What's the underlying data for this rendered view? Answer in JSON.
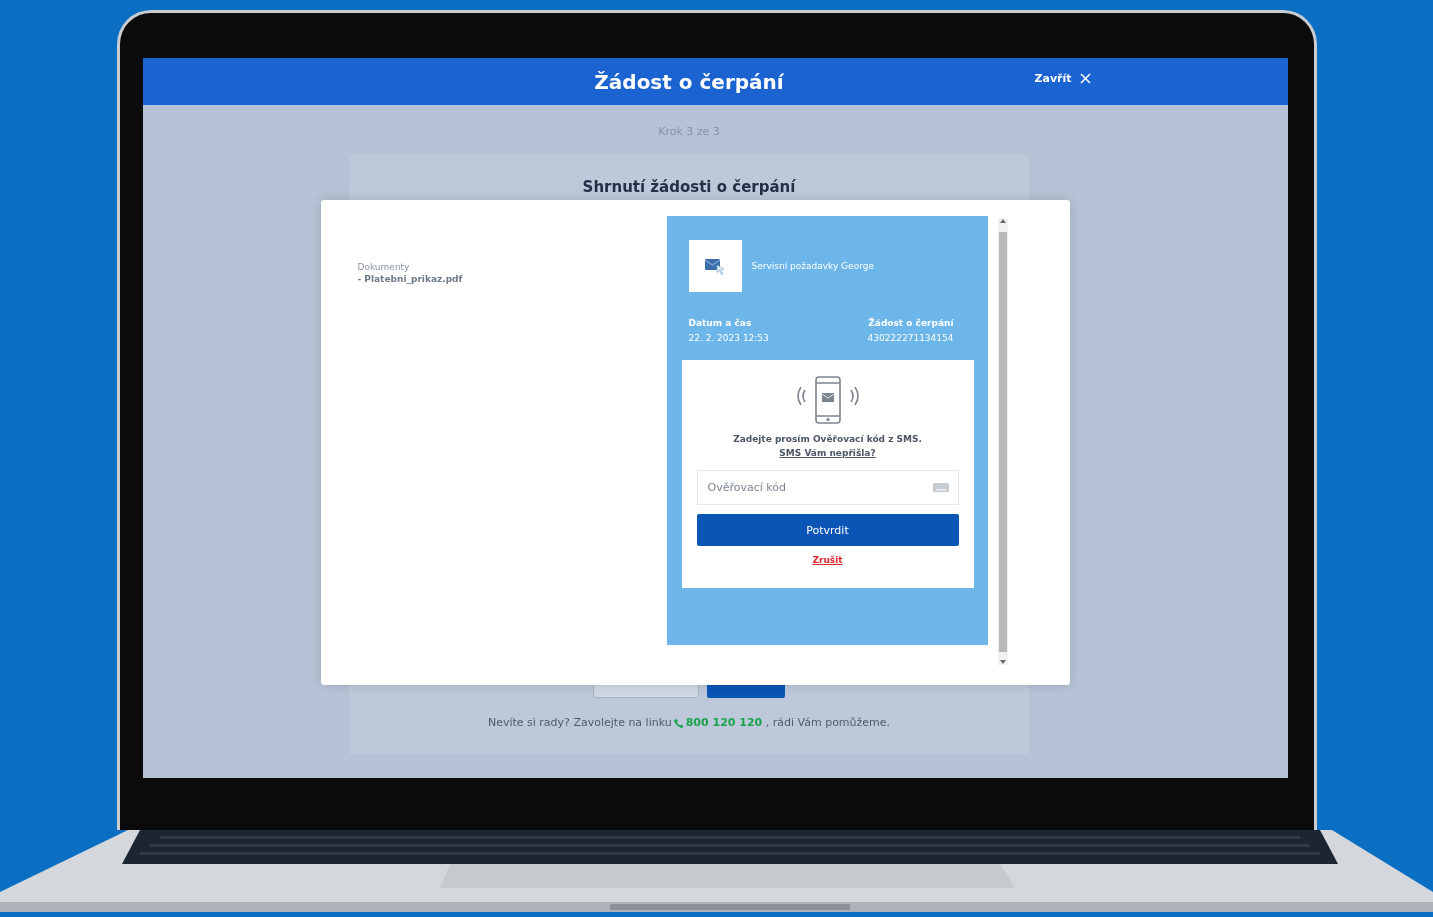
{
  "window": {
    "title": "Žádost o čerpání",
    "close": {
      "label": "Zavřít"
    }
  },
  "step": "Krok 3 ze 3",
  "summary": {
    "title": "Shrnutí žádosti o čerpání",
    "buttons": [
      {
        "kind": "secondary"
      },
      {
        "kind": "primary"
      }
    ]
  },
  "help": {
    "text": "Nevíte si rady? Zavolejte na linku",
    "phone": "800 120 120",
    "after": ", rádi Vám pomůžeme."
  },
  "dialog": {
    "documents_label": "Dokumenty",
    "documents": [
      "- Platebni_prikaz.pdf"
    ],
    "app": {
      "name": "Servisní požadavky George"
    },
    "details": [
      {
        "label": "Datum a čas",
        "value": "22. 2. 2023 12:53"
      },
      {
        "label": "Žádost o čerpání",
        "value": "430222271134154"
      }
    ],
    "sms": {
      "instruction": "Zadejte prosím Ověřovací kód z SMS.",
      "link": "SMS Vám nepřišla?",
      "placeholder": "Ověřovací kód",
      "confirm": "Potvrdit",
      "cancel": "Zrušit"
    }
  }
}
